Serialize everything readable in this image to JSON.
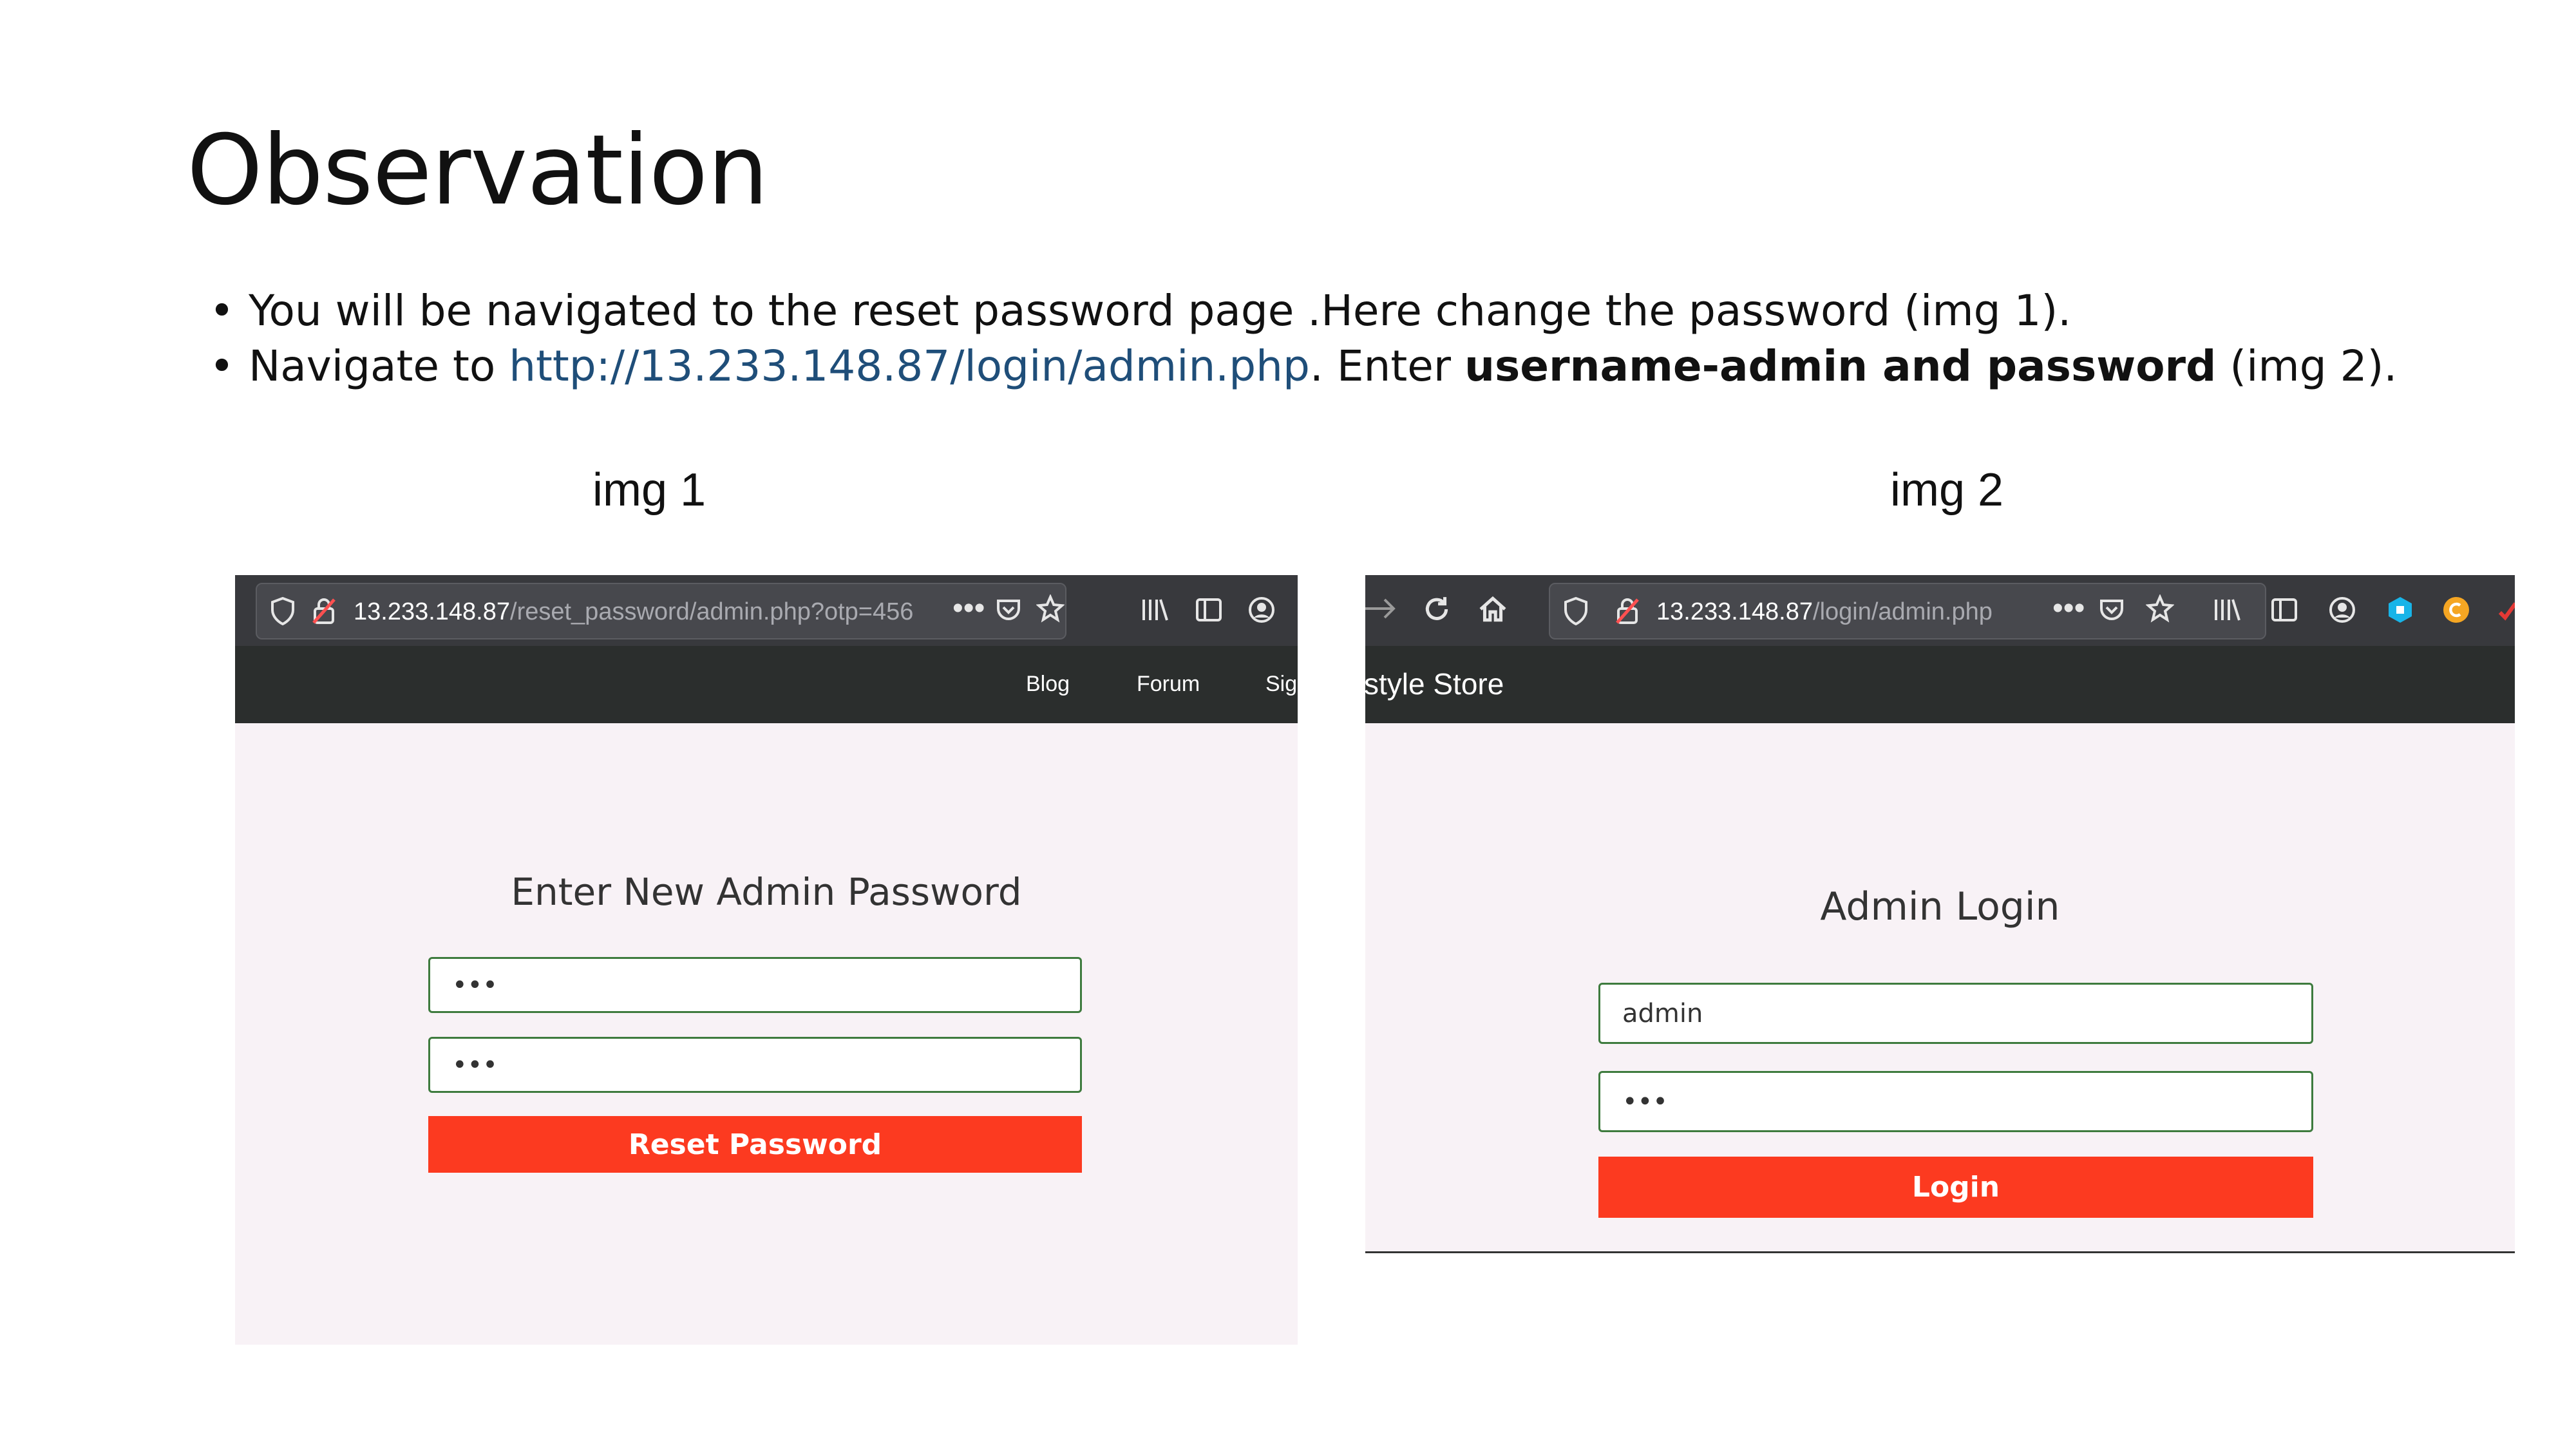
{
  "slide": {
    "title": "Observation",
    "bullet1": "You will be navigated to the reset password page .Here change the password (img 1).",
    "bullet2_prefix": "Navigate to ",
    "bullet2_link": "http://13.233.148.87/login/admin.php",
    "bullet2_mid": ". Enter ",
    "bullet2_bold": "username-admin and password",
    "bullet2_suffix": " (img 2).",
    "caption1": "img 1",
    "caption2": "img 2"
  },
  "img1": {
    "url_host": "13.233.148.87",
    "url_path": "/reset_password/admin.php?otp=456",
    "nav": [
      "Blog",
      "Forum",
      "Sig"
    ],
    "heading": "Enter New Admin Password",
    "field1_value": "•••",
    "field2_value": "•••",
    "button": "Reset Password"
  },
  "img2": {
    "url_host": "13.233.148.87",
    "url_path": "/login/admin.php",
    "brand": "style Store",
    "heading": "Admin Login",
    "username_value": "admin",
    "password_value": "•••",
    "button": "Login"
  },
  "colors": {
    "accent_button": "#fc3a20",
    "field_border": "#3e7b3e",
    "link": "#1f4e79",
    "page_bg": "#f8f2f6"
  }
}
